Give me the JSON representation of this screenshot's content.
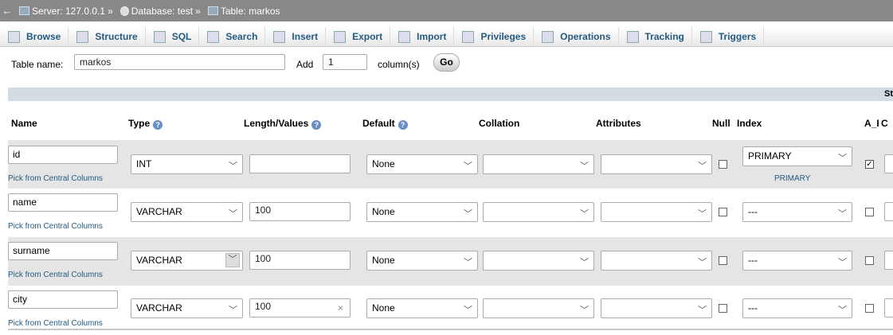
{
  "breadcrumb": {
    "back": "←",
    "server": "Server: 127.0.0.1",
    "database": "Database: test",
    "table": "Table: markos",
    "sep": "»"
  },
  "tabs": [
    {
      "label": "Browse",
      "icon": "browse-icon"
    },
    {
      "label": "Structure",
      "icon": "structure-icon"
    },
    {
      "label": "SQL",
      "icon": "sql-icon"
    },
    {
      "label": "Search",
      "icon": "search-icon"
    },
    {
      "label": "Insert",
      "icon": "insert-icon"
    },
    {
      "label": "Export",
      "icon": "export-icon"
    },
    {
      "label": "Import",
      "icon": "import-icon"
    },
    {
      "label": "Privileges",
      "icon": "privileges-icon"
    },
    {
      "label": "Operations",
      "icon": "operations-icon"
    },
    {
      "label": "Tracking",
      "icon": "tracking-icon"
    },
    {
      "label": "Triggers",
      "icon": "triggers-icon"
    }
  ],
  "form": {
    "table_name_label": "Table name:",
    "table_name_value": "markos",
    "add_label": "Add",
    "add_value": "1",
    "columns_label": "column(s)",
    "go_label": "Go"
  },
  "band_text": "St",
  "headers": {
    "name": "Name",
    "type": "Type",
    "length": "Length/Values",
    "default": "Default",
    "collation": "Collation",
    "attributes": "Attributes",
    "null": "Null",
    "index": "Index",
    "ai": "A_I",
    "comments": "C"
  },
  "pick_label": "Pick from Central Columns",
  "rows": [
    {
      "name": "id",
      "type": "INT",
      "length": "",
      "default": "None",
      "collation": "",
      "attributes": "",
      "null": false,
      "index": "PRIMARY",
      "index_note": "PRIMARY",
      "ai": true
    },
    {
      "name": "name",
      "type": "VARCHAR",
      "length": "100",
      "default": "None",
      "collation": "",
      "attributes": "",
      "null": false,
      "index": "---",
      "index_note": "",
      "ai": false
    },
    {
      "name": "surname",
      "type": "VARCHAR",
      "length": "100",
      "default": "None",
      "collation": "",
      "attributes": "",
      "null": false,
      "index": "---",
      "index_note": "",
      "ai": false
    },
    {
      "name": "city",
      "type": "VARCHAR",
      "length": "100",
      "default": "None",
      "collation": "",
      "attributes": "",
      "null": false,
      "index": "---",
      "index_note": "",
      "ai": false
    }
  ],
  "colors": {
    "link": "#235a81",
    "crumb_bg": "#888888",
    "band": "#d3dce3",
    "row_alt": "#e5e5e5"
  }
}
